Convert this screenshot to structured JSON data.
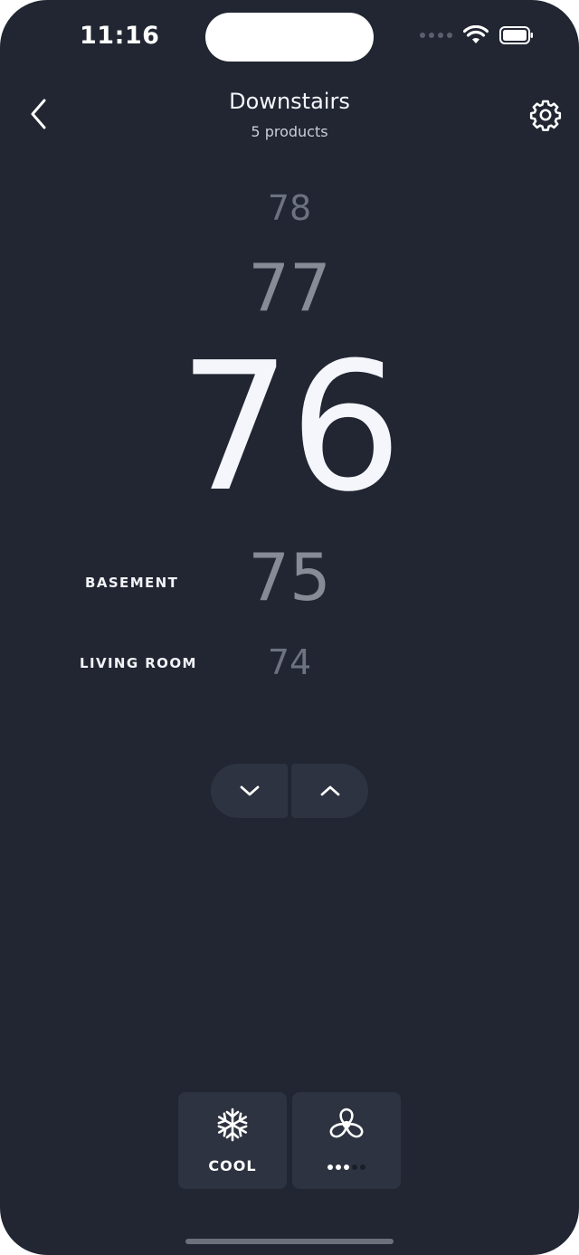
{
  "status_bar": {
    "time": "11:16",
    "icons": [
      "cellular-signal-icon",
      "wifi-icon",
      "battery-icon"
    ]
  },
  "header": {
    "title": "Downstairs",
    "subtitle": "5 products",
    "back_icon": "chevron-left-icon",
    "settings_icon": "gear-icon"
  },
  "temperature_wheel": {
    "values": [
      "78",
      "77",
      "76",
      "75",
      "74"
    ],
    "selected": "76"
  },
  "rooms": [
    {
      "label": "BASEMENT"
    },
    {
      "label": "LIVING ROOM"
    }
  ],
  "stepper": {
    "down_icon": "chevron-down-icon",
    "up_icon": "chevron-up-icon"
  },
  "modes": {
    "cool": {
      "label": "COOL",
      "icon": "snowflake-icon"
    },
    "fan": {
      "icon": "fan-icon",
      "level": 3,
      "max_level": 5
    }
  },
  "colors": {
    "background": "#212632",
    "button": "#2d3340",
    "text": "#f4f6fb",
    "muted": "#868b96"
  }
}
